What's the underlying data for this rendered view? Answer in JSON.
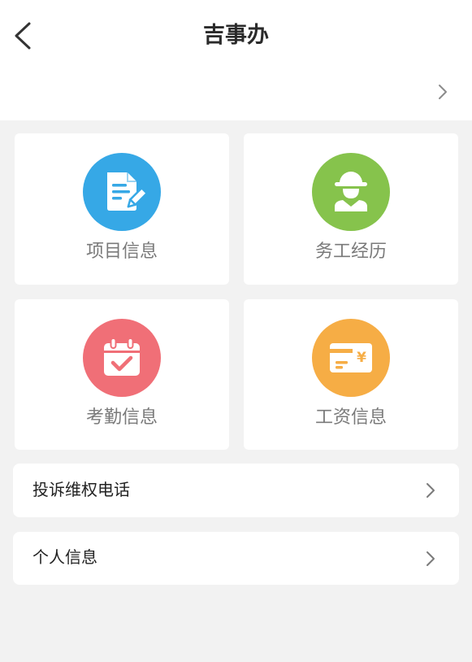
{
  "header": {
    "title": "吉事办",
    "back_icon": "chevron-left-icon",
    "subrow_icon": "chevron-right-icon"
  },
  "grid": {
    "items": [
      {
        "label": "项目信息",
        "icon": "document-edit-icon",
        "color": "#36a8e6"
      },
      {
        "label": "务工经历",
        "icon": "worker-icon",
        "color": "#86c34c"
      },
      {
        "label": "考勤信息",
        "icon": "calendar-check-icon",
        "color": "#f06f77"
      },
      {
        "label": "工资信息",
        "icon": "salary-card-icon",
        "color": "#f6ad45",
        "icon_glyph": "¥"
      }
    ]
  },
  "list": {
    "items": [
      {
        "label": "投诉维权电话",
        "icon": "chevron-right-icon"
      },
      {
        "label": "个人信息",
        "icon": "chevron-right-icon"
      }
    ]
  }
}
